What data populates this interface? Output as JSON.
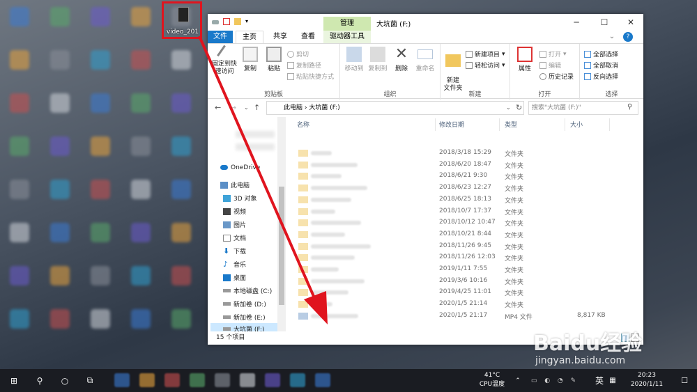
{
  "desktop": {
    "icon_label": "video_201"
  },
  "window": {
    "title": "大坑菌 (F:)",
    "context_tab": "管理",
    "tabs": {
      "file": "文件",
      "home": "主页",
      "share": "共享",
      "view": "查看",
      "drive_tools": "驱动器工具"
    },
    "controls": {
      "minimize": "─",
      "maximize": "☐",
      "close": "✕"
    }
  },
  "ribbon": {
    "clipboard": {
      "label": "剪贴板",
      "pin": "固定到快速访问",
      "copy": "复制",
      "paste": "粘贴",
      "cut": "剪切",
      "copy_path": "复制路径",
      "paste_shortcut": "粘贴快捷方式"
    },
    "organize": {
      "label": "组织",
      "move_to": "移动到",
      "copy_to": "复制到",
      "delete": "删除",
      "rename": "重命名"
    },
    "new": {
      "label": "新建",
      "new_folder": "新建\n文件夹",
      "new_item": "新建项目",
      "easy_access": "轻松访问"
    },
    "open": {
      "label": "打开",
      "properties": "属性",
      "open": "打开",
      "edit": "编辑",
      "history": "历史记录"
    },
    "select": {
      "label": "选择",
      "select_all": "全部选择",
      "select_none": "全部取消",
      "invert": "反向选择"
    }
  },
  "address": {
    "path": "此电脑 › 大坑菌 (F:)",
    "search_placeholder": "搜索\"大坑菌 (F:)\""
  },
  "nav": {
    "items": [
      "OneDrive",
      "此电脑",
      "3D 对象",
      "视频",
      "图片",
      "文档",
      "下载",
      "音乐",
      "桌面",
      "本地磁盘 (C:)",
      "新加卷 (D:)",
      "新加卷 (E:)",
      "大坑菌 (F:)",
      "大坑菌 (F:)"
    ]
  },
  "columns": {
    "name": "名称",
    "date": "修改日期",
    "type": "类型",
    "size": "大小"
  },
  "files": [
    {
      "date": "2018/3/18 15:29",
      "type": "文件夹",
      "size": ""
    },
    {
      "date": "2018/6/20 18:47",
      "type": "文件夹",
      "size": ""
    },
    {
      "date": "2018/6/21 9:30",
      "type": "文件夹",
      "size": ""
    },
    {
      "date": "2018/6/23 12:27",
      "type": "文件夹",
      "size": ""
    },
    {
      "date": "2018/6/25 18:13",
      "type": "文件夹",
      "size": ""
    },
    {
      "date": "2018/10/7 17:37",
      "type": "文件夹",
      "size": ""
    },
    {
      "date": "2018/10/12 10:47",
      "type": "文件夹",
      "size": ""
    },
    {
      "date": "2018/10/21 8:44",
      "type": "文件夹",
      "size": ""
    },
    {
      "date": "2018/11/26 9:45",
      "type": "文件夹",
      "size": ""
    },
    {
      "date": "2018/11/26 12:03",
      "type": "文件夹",
      "size": ""
    },
    {
      "date": "2019/1/11 7:55",
      "type": "文件夹",
      "size": ""
    },
    {
      "date": "2019/3/6 10:16",
      "type": "文件夹",
      "size": ""
    },
    {
      "date": "2019/4/25 11:01",
      "type": "文件夹",
      "size": ""
    },
    {
      "date": "2020/1/5 21:14",
      "type": "文件夹",
      "size": ""
    },
    {
      "date": "2020/1/5 21:17",
      "type": "MP4 文件",
      "size": "8,817 KB"
    }
  ],
  "status": {
    "count": "15 个项目"
  },
  "taskbar": {
    "temp": "41°C",
    "temp_label": "CPU温度",
    "ime": "英",
    "time": "20:23",
    "date": "2020/1/11"
  },
  "watermark": {
    "brand": "Baidu经验",
    "url": "jingyan.baidu.com"
  },
  "colors": {
    "accent": "#1979ca",
    "arrow": "#e0141e",
    "selection": "#cce8ff"
  }
}
